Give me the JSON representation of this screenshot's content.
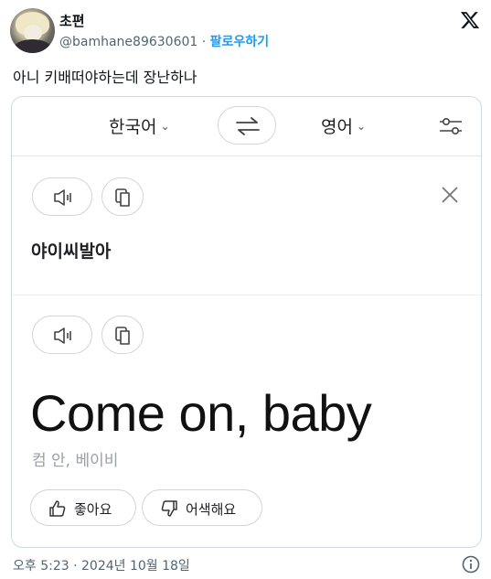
{
  "author": {
    "display_name": "초편",
    "handle": "@bamhane89630601",
    "separator": " · ",
    "follow_label": "팔로우하기"
  },
  "tweet": {
    "text": "아니 키배떠야하는데 장난하나"
  },
  "translator": {
    "source_lang": "한국어",
    "target_lang": "영어",
    "caret": "⌄",
    "source_text": "야이씨발아",
    "translated_text": "Come on, baby",
    "pronunciation": "컴 안, 베이비",
    "like_label": "좋아요",
    "dislike_label": "어색해요"
  },
  "footer": {
    "timestamp": "오후 5:23 · 2024년 10월 18일"
  },
  "icons": {
    "x_logo": "x-logo-icon",
    "swap": "swap-icon",
    "settings": "settings-sliders-icon",
    "speaker": "speaker-icon",
    "copy": "copy-icon",
    "close": "close-icon",
    "thumbs_up": "thumbs-up-icon",
    "thumbs_down": "thumbs-down-icon",
    "info": "info-icon"
  },
  "colors": {
    "link_blue": "#1d9bf0",
    "muted": "#536471",
    "border": "#cfd9de"
  }
}
